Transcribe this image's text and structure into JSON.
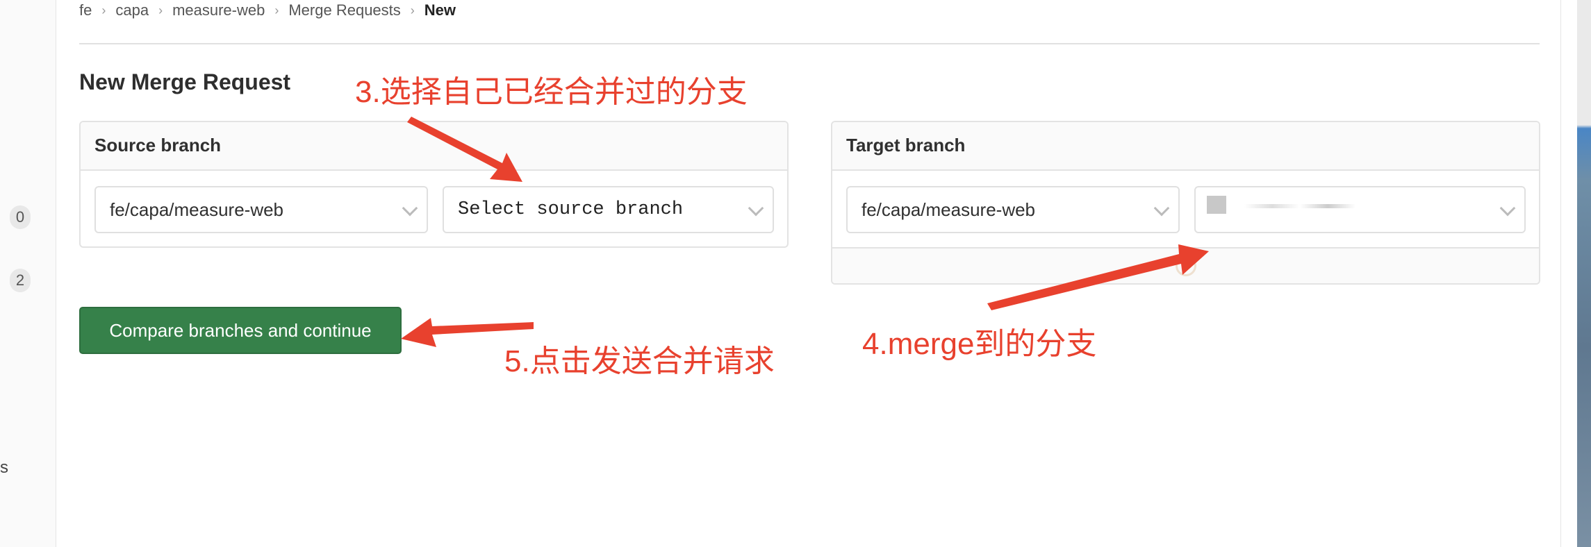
{
  "breadcrumb": [
    "fe",
    "capa",
    "measure-web",
    "Merge Requests",
    "New"
  ],
  "sidebar": {
    "badges": [
      "0",
      "2"
    ],
    "partial_label": "s"
  },
  "page_title": "New Merge Request",
  "source": {
    "header": "Source branch",
    "project_select": "fe/capa/measure-web",
    "branch_select": "Select source branch"
  },
  "target": {
    "header": "Target branch",
    "project_select": "fe/capa/measure-web",
    "branch_select": "(blurred)"
  },
  "compare_button": "Compare branches and continue",
  "annotations": {
    "step3": "3.选择自己已经合并过的分支",
    "step4": "4.merge到的分支",
    "step5": "5.点击发送合并请求"
  },
  "colors": {
    "button": "#36814a",
    "annotation": "#e8412e"
  }
}
